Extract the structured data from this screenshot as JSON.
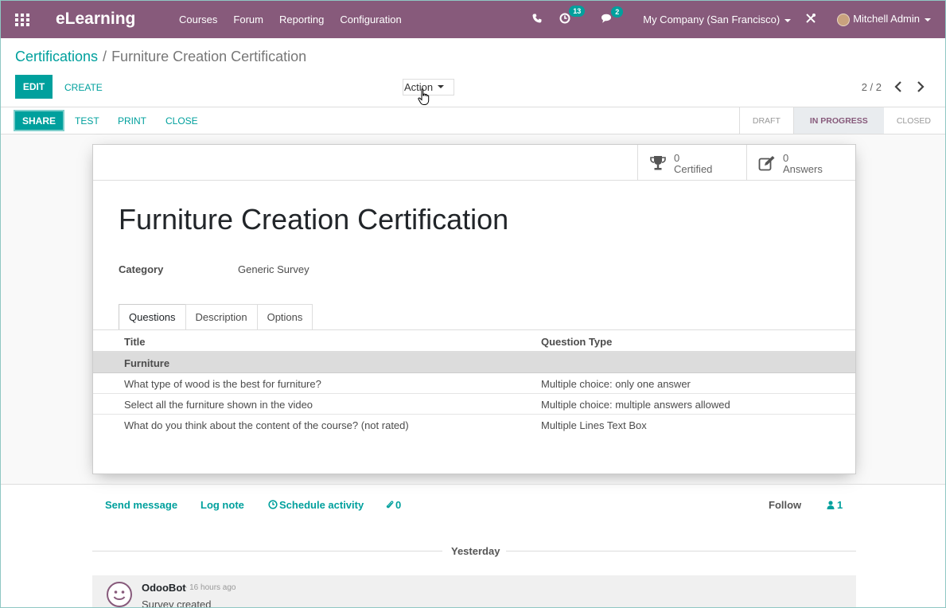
{
  "navbar": {
    "brand": "eLearning",
    "menu": [
      "Courses",
      "Forum",
      "Reporting",
      "Configuration"
    ],
    "activity_count": "13",
    "message_count": "2",
    "company": "My Company (San Francisco)",
    "user": "Mitchell Admin",
    "color": "#875a7b"
  },
  "breadcrumb": {
    "parent": "Certifications",
    "separator": "/",
    "current": "Furniture Creation Certification"
  },
  "control": {
    "edit": "EDIT",
    "create": "CREATE",
    "action": "Action",
    "pager": "2 / 2"
  },
  "statusbar": {
    "buttons": [
      "SHARE",
      "TEST",
      "PRINT",
      "CLOSE"
    ],
    "stages": [
      "DRAFT",
      "IN PROGRESS",
      "CLOSED"
    ],
    "active_stage": "IN PROGRESS"
  },
  "stats": {
    "certified_count": "0",
    "certified_label": "Certified",
    "answers_count": "0",
    "answers_label": "Answers"
  },
  "record": {
    "title": "Furniture Creation Certification",
    "category_label": "Category",
    "category_value": "Generic Survey"
  },
  "tabs": [
    "Questions",
    "Description",
    "Options"
  ],
  "questions": {
    "columns": [
      "Title",
      "Question Type"
    ],
    "section": "Furniture",
    "rows": [
      {
        "title": "What type of wood is the best for furniture?",
        "type": "Multiple choice: only one answer"
      },
      {
        "title": "Select all the furniture shown in the video",
        "type": "Multiple choice: multiple answers allowed"
      },
      {
        "title": "What do you think about the content of the course? (not rated)",
        "type": "Multiple Lines Text Box"
      }
    ]
  },
  "chatter": {
    "send_message": "Send message",
    "log_note": "Log note",
    "schedule_activity": "Schedule activity",
    "attachments": "0",
    "follow": "Follow",
    "followers": "1",
    "date_separator": "Yesterday",
    "message": {
      "author": "OdooBot",
      "time": "- 16 hours ago",
      "body": "Survey created"
    }
  },
  "accent_color": "#00a09d"
}
